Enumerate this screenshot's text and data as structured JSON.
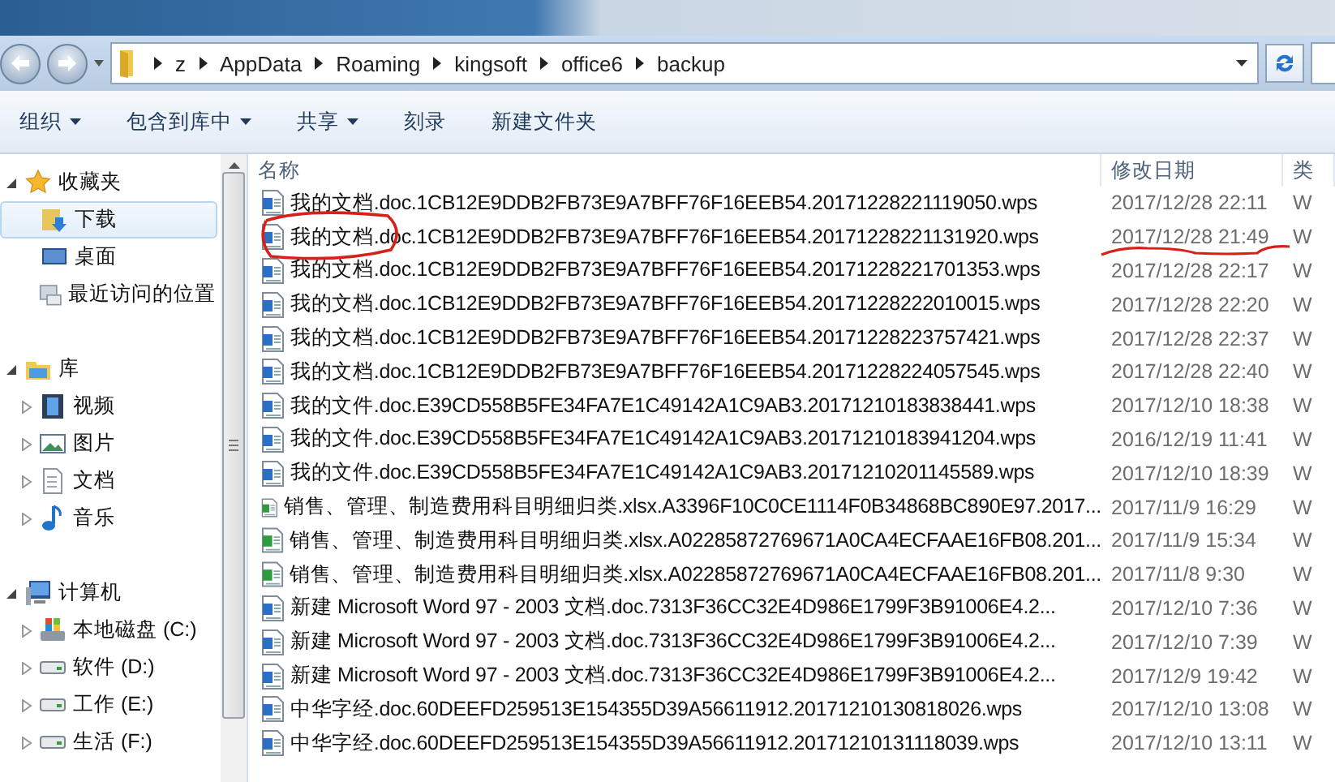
{
  "address_path": [
    "z",
    "AppData",
    "Roaming",
    "kingsoft",
    "office6",
    "backup"
  ],
  "toolbar": [
    {
      "label": "组织",
      "dropdown": true
    },
    {
      "label": "包含到库中",
      "dropdown": true
    },
    {
      "label": "共享",
      "dropdown": true
    },
    {
      "label": "刻录",
      "dropdown": false
    },
    {
      "label": "新建文件夹",
      "dropdown": false
    }
  ],
  "sidebar": [
    {
      "label": "收藏夹",
      "expanded": true,
      "selected": false,
      "children": [
        {
          "label": "下载",
          "selected": true
        },
        {
          "label": "桌面",
          "selected": false
        },
        {
          "label": "最近访问的位置",
          "selected": false
        }
      ]
    },
    {
      "label": "库",
      "expanded": true,
      "selected": false,
      "children": [
        {
          "label": "视频",
          "expanded": false,
          "selected": false
        },
        {
          "label": "图片",
          "expanded": false,
          "selected": false
        },
        {
          "label": "文档",
          "expanded": false,
          "selected": false
        },
        {
          "label": "音乐",
          "expanded": false,
          "selected": false
        }
      ]
    },
    {
      "label": "计算机",
      "expanded": true,
      "selected": false,
      "children": [
        {
          "label": "本地磁盘 (C:)",
          "expanded": false,
          "selected": false
        },
        {
          "label": "软件 (D:)",
          "expanded": false,
          "selected": false
        },
        {
          "label": "工作 (E:)",
          "expanded": false,
          "selected": false
        },
        {
          "label": "生活 (F:)",
          "expanded": false,
          "selected": false
        }
      ]
    }
  ],
  "file_list": {
    "columns": [
      "名称",
      "修改日期",
      "类"
    ],
    "rows": [
      {
        "kind": "doc",
        "name": "我的文档.doc.1CB12E9DDB2FB73E9A7BFF76F16EEB54.20171228221119050.wps",
        "modified": "2017/12/28 22:11",
        "type": "W"
      },
      {
        "kind": "doc",
        "name": "我的文档.doc.1CB12E9DDB2FB73E9A7BFF76F16EEB54.20171228221131920.wps",
        "modified": "2017/12/28 21:49",
        "type": "W"
      },
      {
        "kind": "doc",
        "name": "我的文档.doc.1CB12E9DDB2FB73E9A7BFF76F16EEB54.20171228221701353.wps",
        "modified": "2017/12/28 22:17",
        "type": "W"
      },
      {
        "kind": "doc",
        "name": "我的文档.doc.1CB12E9DDB2FB73E9A7BFF76F16EEB54.20171228222010015.wps",
        "modified": "2017/12/28 22:20",
        "type": "W"
      },
      {
        "kind": "doc",
        "name": "我的文档.doc.1CB12E9DDB2FB73E9A7BFF76F16EEB54.20171228223757421.wps",
        "modified": "2017/12/28 22:37",
        "type": "W"
      },
      {
        "kind": "doc",
        "name": "我的文档.doc.1CB12E9DDB2FB73E9A7BFF76F16EEB54.20171228224057545.wps",
        "modified": "2017/12/28 22:40",
        "type": "W"
      },
      {
        "kind": "doc",
        "name": "我的文件.doc.E39CD558B5FE34FA7E1C49142A1C9AB3.20171210183838441.wps",
        "modified": "2017/12/10 18:38",
        "type": "W"
      },
      {
        "kind": "doc",
        "name": "我的文件.doc.E39CD558B5FE34FA7E1C49142A1C9AB3.20171210183941204.wps",
        "modified": "2016/12/19 11:41",
        "type": "W"
      },
      {
        "kind": "doc",
        "name": "我的文件.doc.E39CD558B5FE34FA7E1C49142A1C9AB3.20171210201145589.wps",
        "modified": "2017/12/10 18:39",
        "type": "W"
      },
      {
        "kind": "sheet",
        "name": "销售、管理、制造费用科目明细归类.xlsx.A3396F10C0CE1114F0B34868BC890E97.2017...",
        "modified": "2017/11/9 16:29",
        "type": "W"
      },
      {
        "kind": "sheet",
        "name": "销售、管理、制造费用科目明细归类.xlsx.A02285872769671A0CA4ECFAAE16FB08.201...",
        "modified": "2017/11/9 15:34",
        "type": "W"
      },
      {
        "kind": "sheet",
        "name": "销售、管理、制造费用科目明细归类.xlsx.A02285872769671A0CA4ECFAAE16FB08.201...",
        "modified": "2017/11/8 9:30",
        "type": "W"
      },
      {
        "kind": "doc",
        "name": "新建 Microsoft Word 97 - 2003 文档.doc.7313F36CC32E4D986E1799F3B91006E4.2...",
        "modified": "2017/12/10 7:36",
        "type": "W"
      },
      {
        "kind": "doc",
        "name": "新建 Microsoft Word 97 - 2003 文档.doc.7313F36CC32E4D986E1799F3B91006E4.2...",
        "modified": "2017/12/10 7:39",
        "type": "W"
      },
      {
        "kind": "doc",
        "name": "新建 Microsoft Word 97 - 2003 文档.doc.7313F36CC32E4D986E1799F3B91006E4.2...",
        "modified": "2017/12/9 19:42",
        "type": "W"
      },
      {
        "kind": "doc",
        "name": "中华字经.doc.60DEEFD259513E154355D39A56611912.20171210130818026.wps",
        "modified": "2017/12/10 13:08",
        "type": "W"
      },
      {
        "kind": "doc",
        "name": "中华字经.doc.60DEEFD259513E154355D39A56611912.20171210131118039.wps",
        "modified": "2017/12/10 13:11",
        "type": "W"
      }
    ]
  }
}
